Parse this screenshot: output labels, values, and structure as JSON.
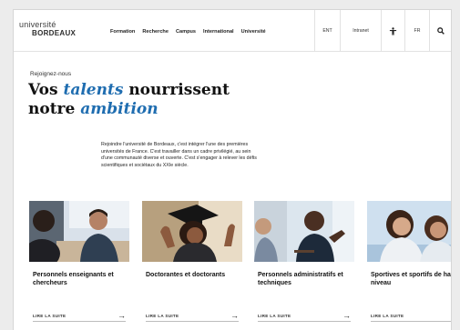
{
  "logo": {
    "line1": "université",
    "line2": "BORDEAUX"
  },
  "nav": [
    "Formation",
    "Recherche",
    "Campus",
    "International",
    "Université"
  ],
  "utility": {
    "ent": "ENT",
    "intranet": "Intranet",
    "lang": "FR",
    "accessibility_icon": "accessibility-icon",
    "search_icon": "search-icon"
  },
  "hero": {
    "kicker": "Rejoignez-nous",
    "headline_1": "Vos ",
    "headline_em1": "talents",
    "headline_2": " nourrissent",
    "headline_3": "notre ",
    "headline_em2": "ambition",
    "intro": "Rejoindre l'université de Bordeaux, c'est intégrer l'une des premières universités de France. C'est travailler dans un cadre privilégié, au sein d'une communauté diverse et ouverte. C'est s'engager à relever les défis scientifiques et sociétaux du XXIe siècle."
  },
  "cards": [
    {
      "title": "Personnels enseignants et chercheurs",
      "more": "LIRE LA SUITE",
      "arrow": "→"
    },
    {
      "title": "Doctorantes et doctorants",
      "more": "LIRE LA SUITE",
      "arrow": "→"
    },
    {
      "title": "Personnels administratifs et techniques",
      "more": "LIRE LA SUITE",
      "arrow": "→"
    },
    {
      "title": "Sportives et sportifs de haut niveau",
      "more": "LIRE LA SUITE",
      "arrow": "→"
    }
  ],
  "colors": {
    "accent": "#1f6db0"
  }
}
